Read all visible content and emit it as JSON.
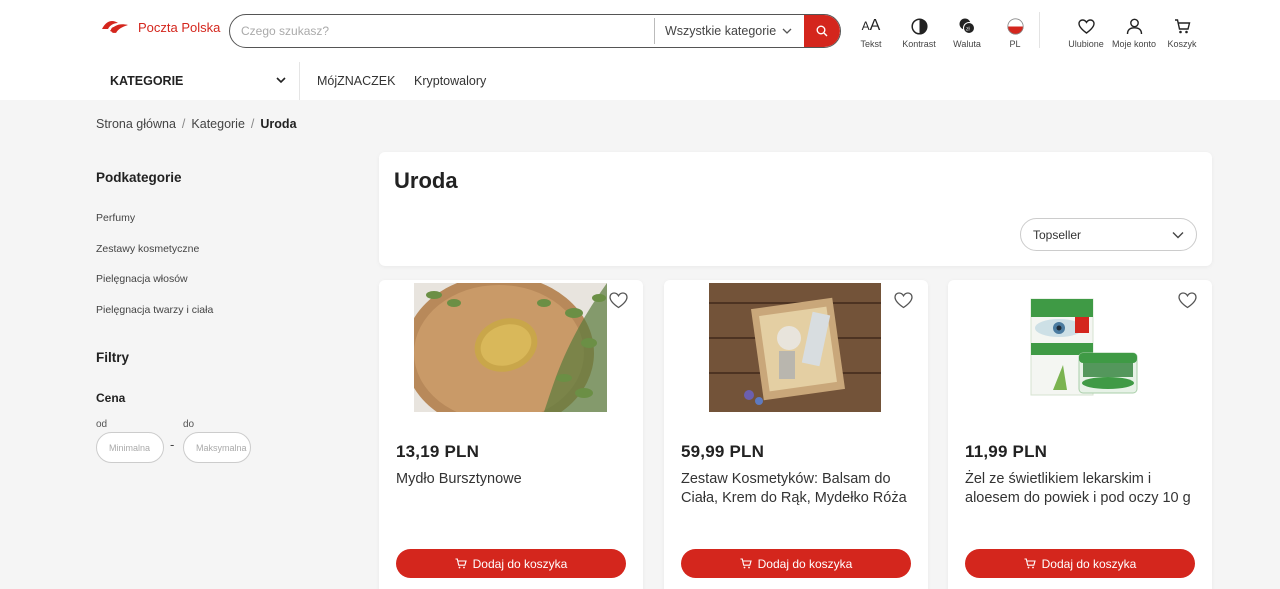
{
  "brand": {
    "name": "Poczta Polska",
    "color": "#d4261d"
  },
  "search": {
    "placeholder": "Czego szukasz?",
    "category": "Wszystkie kategorie"
  },
  "tools": [
    {
      "icon": "text-size-icon",
      "label": "Tekst"
    },
    {
      "icon": "contrast-icon",
      "label": "Kontrast"
    },
    {
      "icon": "currency-icon",
      "label": "Waluta"
    },
    {
      "icon": "flag-pl-icon",
      "label": "PL"
    },
    {
      "icon": "heart-icon",
      "label": "Ulubione"
    },
    {
      "icon": "user-icon",
      "label": "Moje konto"
    },
    {
      "icon": "cart-icon",
      "label": "Koszyk"
    }
  ],
  "nav": {
    "categories": "KATEGORIE",
    "links": [
      "MójZNACZEK",
      "Kryptowalory"
    ]
  },
  "breadcrumb": {
    "home": "Strona główna",
    "categories": "Kategorie",
    "current": "Uroda"
  },
  "sidebar": {
    "subcategories_title": "Podkategorie",
    "subcategories": [
      "Perfumy",
      "Zestawy kosmetyczne",
      "Pielęgnacja włosów",
      "Pielęgnacja twarzy i ciała"
    ],
    "filters_title": "Filtry",
    "price_title": "Cena",
    "from_label": "od",
    "to_label": "do",
    "min_placeholder": "Minimalna",
    "max_placeholder": "Maksymalna",
    "dash": "-"
  },
  "main": {
    "title": "Uroda",
    "sort": "Topseller"
  },
  "products": [
    {
      "price": "13,19 PLN",
      "name": "Mydło Bursztynowe",
      "button": "Dodaj do koszyka"
    },
    {
      "price": "59,99 PLN",
      "name": "Zestaw Kosmetyków: Balsam do Ciała, Krem do Rąk, Mydełko Róża",
      "button": "Dodaj do koszyka"
    },
    {
      "price": "11,99 PLN",
      "name": "Żel ze świetlikiem lekarskim i aloesem do powiek i pod oczy 10 g",
      "button": "Dodaj do koszyka"
    }
  ]
}
